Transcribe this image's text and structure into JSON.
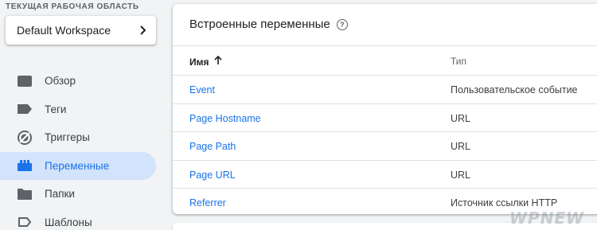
{
  "sidebar": {
    "workspace_label": "ТЕКУЩАЯ РАБОЧАЯ ОБЛАСТЬ",
    "workspace_name": "Default Workspace",
    "items": [
      {
        "label": "Обзор",
        "icon": "folder-overview-icon"
      },
      {
        "label": "Теги",
        "icon": "tag-icon"
      },
      {
        "label": "Триггеры",
        "icon": "trigger-icon"
      },
      {
        "label": "Переменные",
        "icon": "variables-icon",
        "active": true
      },
      {
        "label": "Папки",
        "icon": "folder-icon"
      },
      {
        "label": "Шаблоны",
        "icon": "template-icon"
      }
    ]
  },
  "main": {
    "title": "Встроенные переменные",
    "columns": {
      "name": "Имя",
      "type": "Тип"
    },
    "rows": [
      {
        "name": "Event",
        "type": "Пользовательское событие"
      },
      {
        "name": "Page Hostname",
        "type": "URL"
      },
      {
        "name": "Page Path",
        "type": "URL"
      },
      {
        "name": "Page URL",
        "type": "URL"
      },
      {
        "name": "Referrer",
        "type": "Источник ссылки HTTP"
      }
    ]
  },
  "watermark": "WPNEW",
  "colors": {
    "accent": "#1a73e8",
    "active_bg": "#d2e3fc",
    "icon": "#5f6368"
  }
}
